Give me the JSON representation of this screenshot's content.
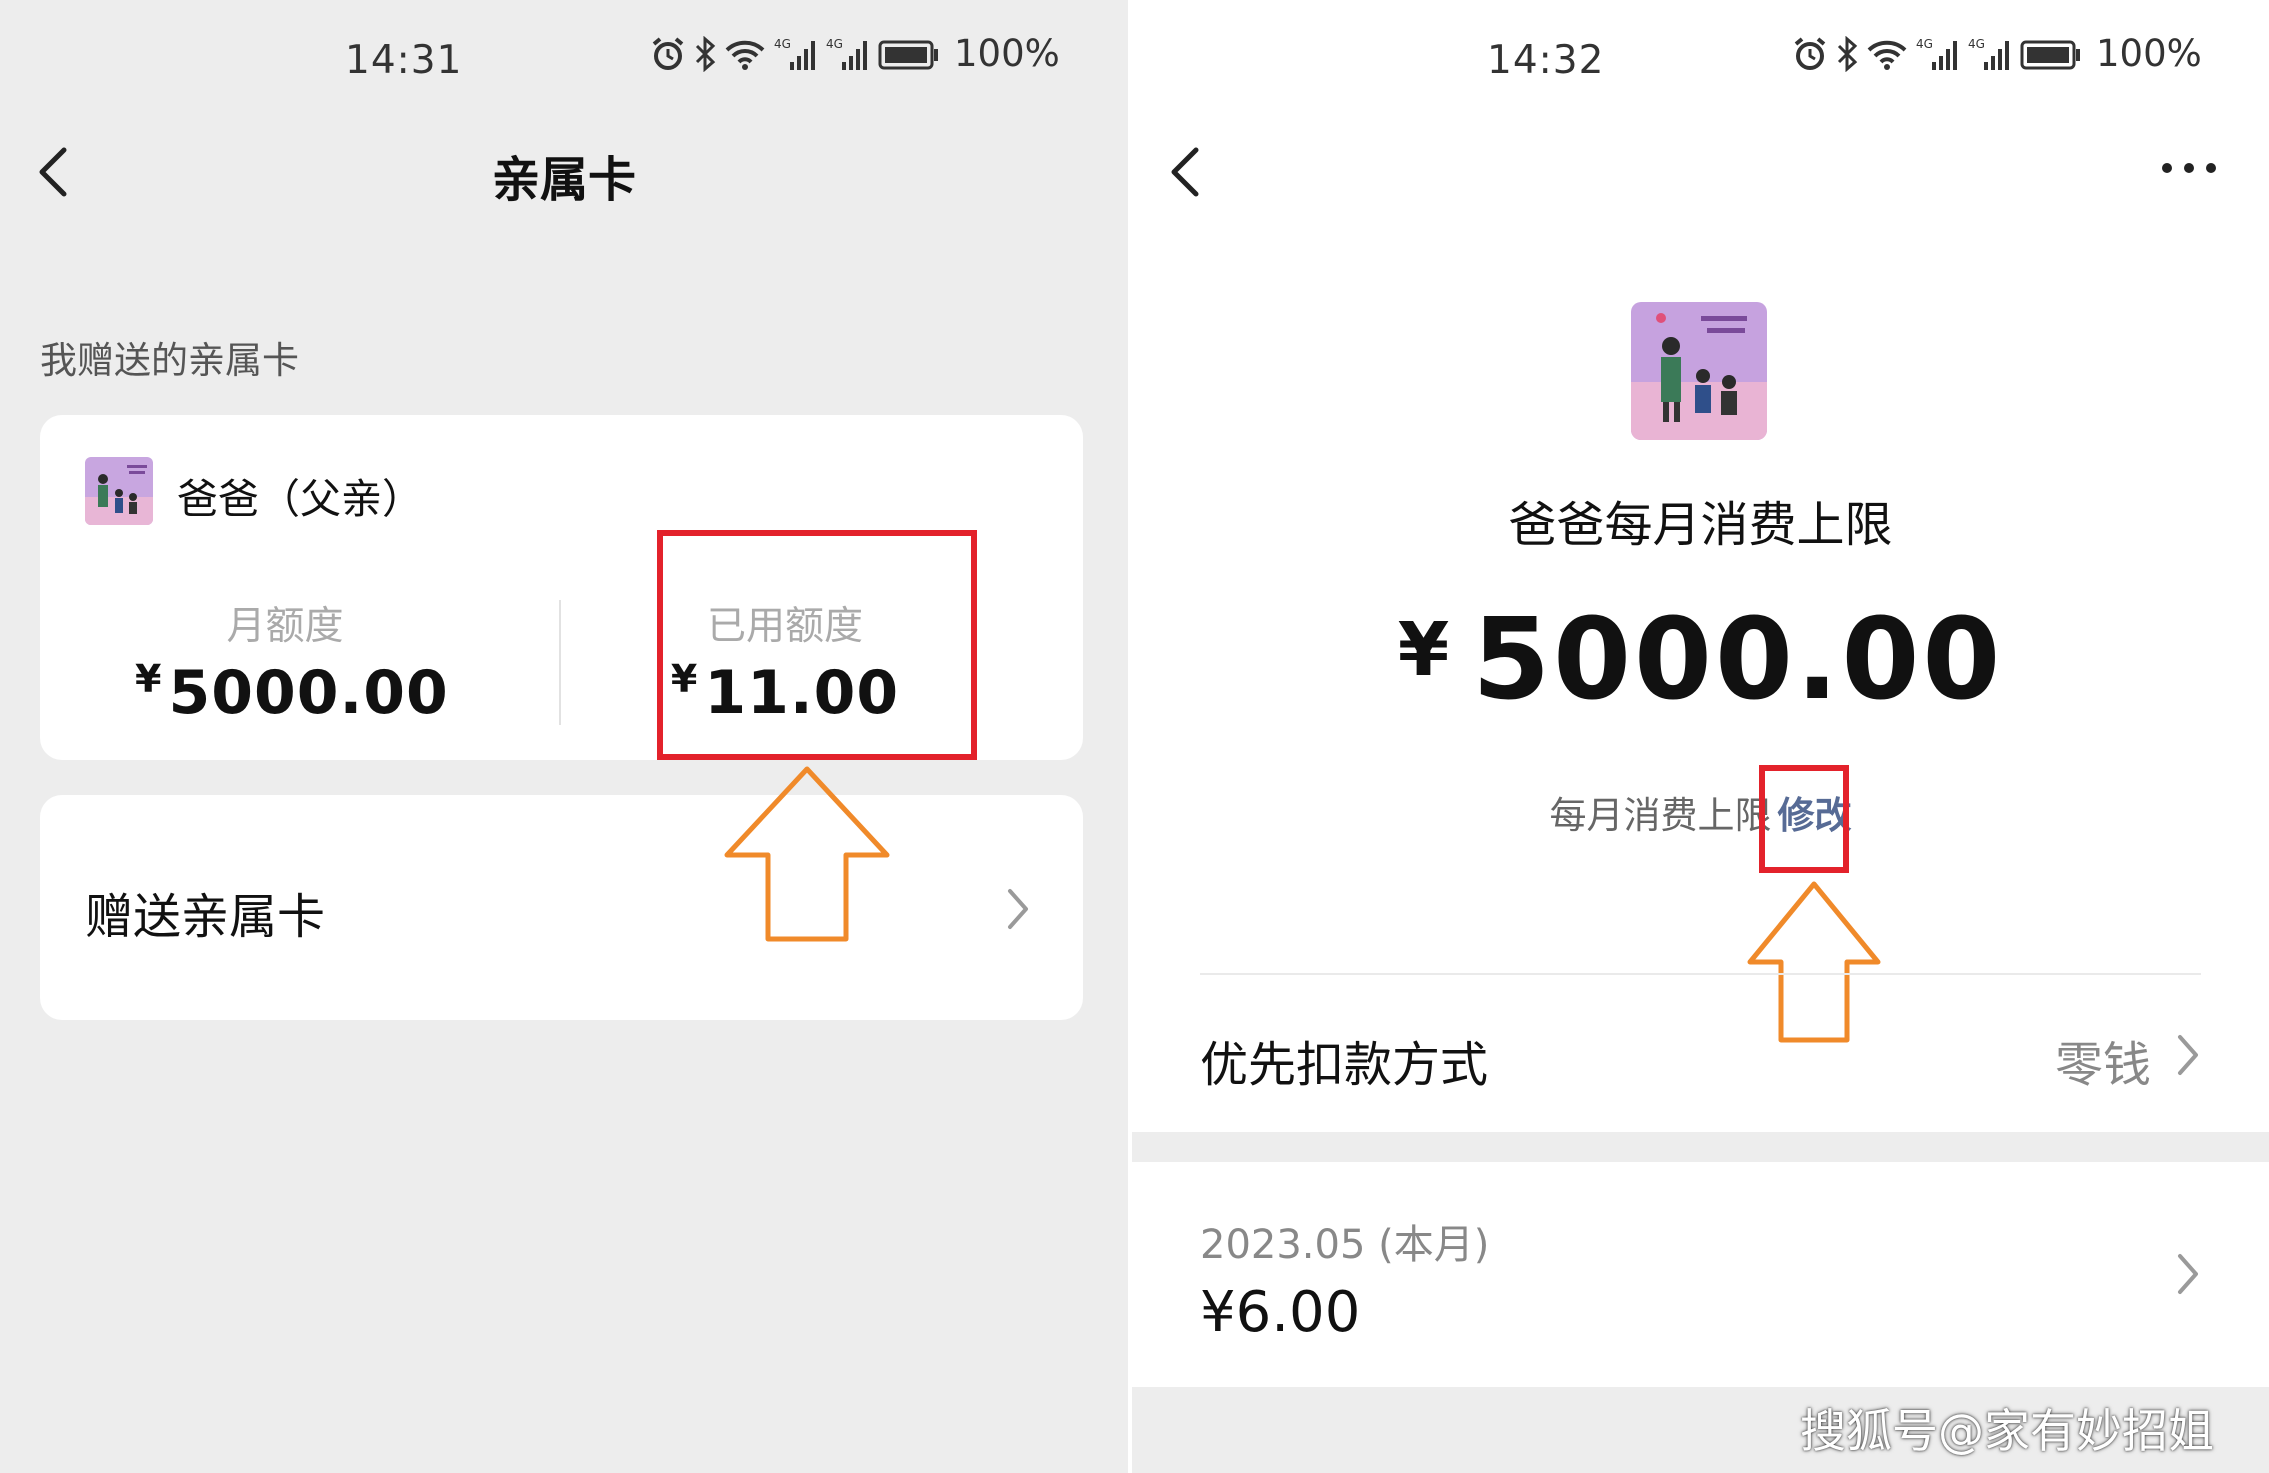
{
  "left": {
    "status_bar": {
      "time": "14:31",
      "battery": "100%"
    },
    "nav": {
      "title": "亲属卡"
    },
    "section_label": "我赠送的亲属卡",
    "card": {
      "member_name": "爸爸（父亲）",
      "monthly_quota_label": "月额度",
      "monthly_quota_yen": "¥",
      "monthly_quota_value": "5000.00",
      "used_quota_label": "已用额度",
      "used_quota_yen": "¥",
      "used_quota_value": "11.00"
    },
    "gift_row_label": "赠送亲属卡"
  },
  "right": {
    "status_bar": {
      "time": "14:32",
      "battery": "100%"
    },
    "limit_title": "爸爸每月消费上限",
    "limit_yen": "¥",
    "limit_amount": "5000.00",
    "limit_sub_label": "每月消费上限",
    "modify_label": "修改",
    "payment_label": "优先扣款方式",
    "payment_value": "零钱",
    "month_label": "2023.05 (本月)",
    "month_amount": "¥6.00"
  },
  "watermark": "搜狐号@家有妙招姐",
  "colors": {
    "highlight": "#e3222b",
    "arrow": "#f08a2a",
    "link": "#576b95",
    "background": "#ededed"
  },
  "icons": [
    "back-arrow-icon",
    "more-icon",
    "chevron-right-icon",
    "alarm-icon",
    "bluetooth-icon",
    "wifi-icon",
    "signal-icon",
    "battery-icon"
  ]
}
